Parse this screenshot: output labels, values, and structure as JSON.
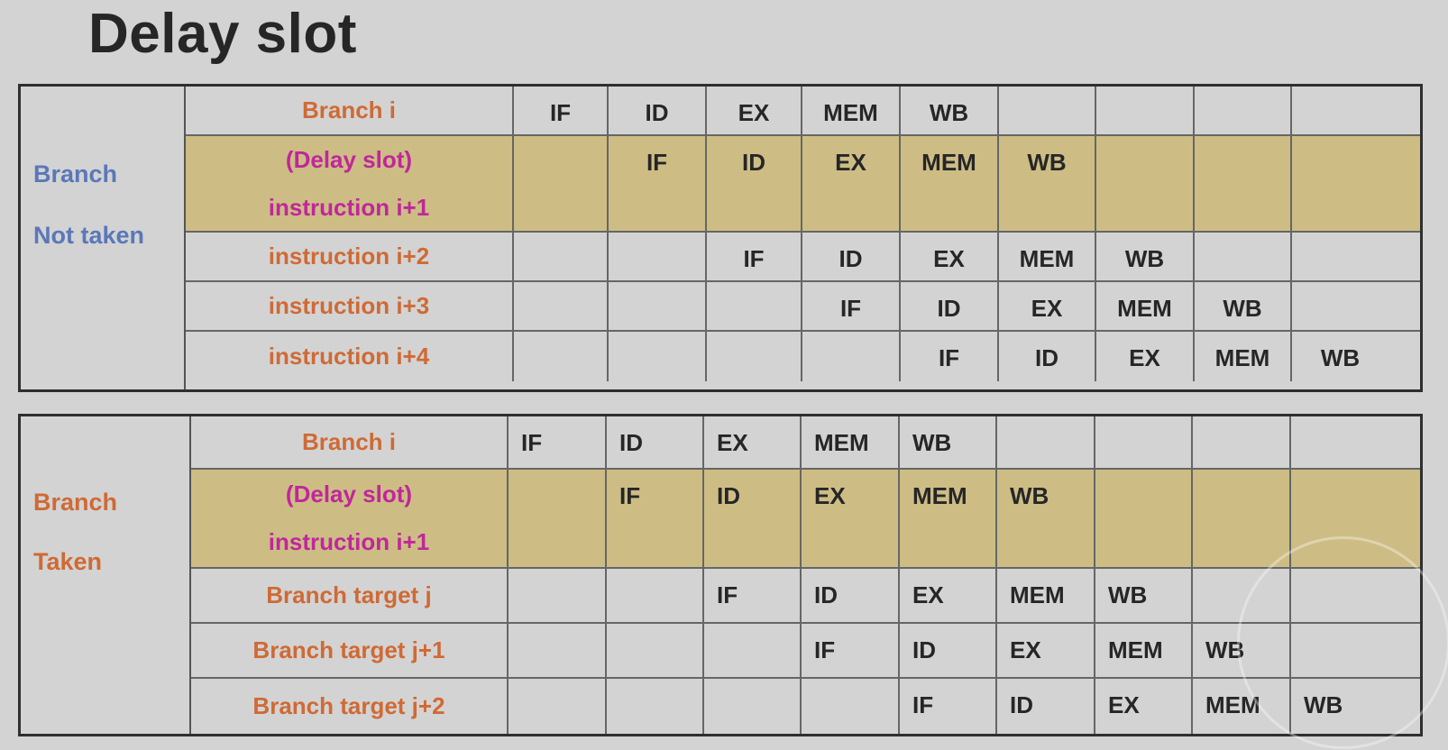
{
  "slide": {
    "title": "Delay slot"
  },
  "colors": {
    "title_text": "#262626",
    "instruction_label": "#cf6a35",
    "delay_slot_label": "#c0279a",
    "not_taken_label": "#5a78b8",
    "taken_label": "#cf6a35",
    "delay_row_fill": "#cdbd85",
    "background": "#d3d3d3"
  },
  "tables": [
    {
      "side_label": [
        "Branch",
        "Not taken"
      ],
      "rows": [
        {
          "label": [
            "Branch i"
          ],
          "delay": false,
          "stages": [
            "IF",
            "ID",
            "EX",
            "MEM",
            "WB",
            "",
            "",
            "",
            ""
          ]
        },
        {
          "label": [
            "(Delay slot)",
            "instruction i+1"
          ],
          "delay": true,
          "stages": [
            "",
            "IF",
            "ID",
            "EX",
            "MEM",
            "WB",
            "",
            "",
            ""
          ]
        },
        {
          "label": [
            "instruction i+2"
          ],
          "delay": false,
          "stages": [
            "",
            "",
            "IF",
            "ID",
            "EX",
            "MEM",
            "WB",
            "",
            ""
          ]
        },
        {
          "label": [
            "instruction i+3"
          ],
          "delay": false,
          "stages": [
            "",
            "",
            "",
            "IF",
            "ID",
            "EX",
            "MEM",
            "WB",
            ""
          ]
        },
        {
          "label": [
            "instruction i+4"
          ],
          "delay": false,
          "stages": [
            "",
            "",
            "",
            "",
            "IF",
            "ID",
            "EX",
            "MEM",
            "WB"
          ]
        }
      ]
    },
    {
      "side_label": [
        "Branch",
        "Taken"
      ],
      "rows": [
        {
          "label": [
            "Branch i"
          ],
          "delay": false,
          "stages": [
            "IF",
            "ID",
            "EX",
            "MEM",
            "WB",
            "",
            "",
            "",
            ""
          ]
        },
        {
          "label": [
            "(Delay slot)",
            "instruction i+1"
          ],
          "delay": true,
          "stages": [
            "",
            "IF",
            "ID",
            "EX",
            "MEM",
            "WB",
            "",
            "",
            ""
          ]
        },
        {
          "label": [
            "Branch target  j"
          ],
          "delay": false,
          "stages": [
            "",
            "",
            "IF",
            "ID",
            "EX",
            "MEM",
            "WB",
            "",
            ""
          ]
        },
        {
          "label": [
            "Branch target  j+1"
          ],
          "delay": false,
          "stages": [
            "",
            "",
            "",
            "IF",
            "ID",
            "EX",
            "MEM",
            "WB",
            ""
          ]
        },
        {
          "label": [
            "Branch target  j+2"
          ],
          "delay": false,
          "stages": [
            "",
            "",
            "",
            "",
            "IF",
            "ID",
            "EX",
            "MEM",
            "WB"
          ]
        }
      ]
    }
  ]
}
